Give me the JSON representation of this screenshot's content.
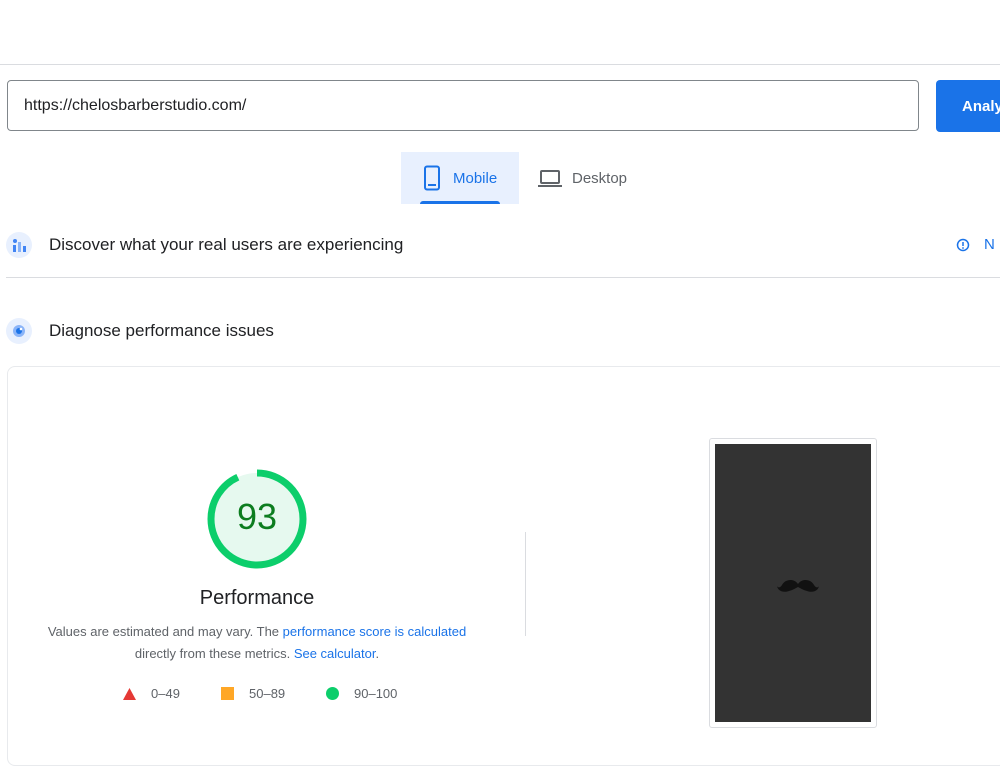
{
  "search": {
    "url_value": "https://chelosbarberstudio.com/",
    "analyze_label": "Analy"
  },
  "tabs": [
    {
      "label": "Mobile",
      "selected": true,
      "icon": "smartphone-icon"
    },
    {
      "label": "Desktop",
      "selected": false,
      "icon": "laptop-icon"
    }
  ],
  "field_data": {
    "title": "Discover what your real users are experiencing",
    "link_partial": "N",
    "icon": "users-chart-icon"
  },
  "diagnose": {
    "title": "Diagnose performance issues",
    "icon": "lighthouse-icon"
  },
  "performance": {
    "score": "93",
    "score_fraction": 0.93,
    "label": "Performance",
    "desc_part1": "Values are estimated and may vary. The ",
    "desc_link1": "performance score is calculated",
    "desc_part2": " directly from these metrics. ",
    "desc_link2": "See calculator",
    "desc_part3": "."
  },
  "legend": [
    {
      "range": "0–49",
      "color": "#e53935",
      "shape": "triangle"
    },
    {
      "range": "50–89",
      "color": "#ffa726",
      "shape": "square"
    },
    {
      "range": "90–100",
      "color": "#0cce6b",
      "shape": "circle"
    }
  ],
  "colors": {
    "accent": "#1a73e8",
    "good": "#0cce6b",
    "score_text": "#0c7d1f",
    "screenshot_bg": "#333333"
  }
}
